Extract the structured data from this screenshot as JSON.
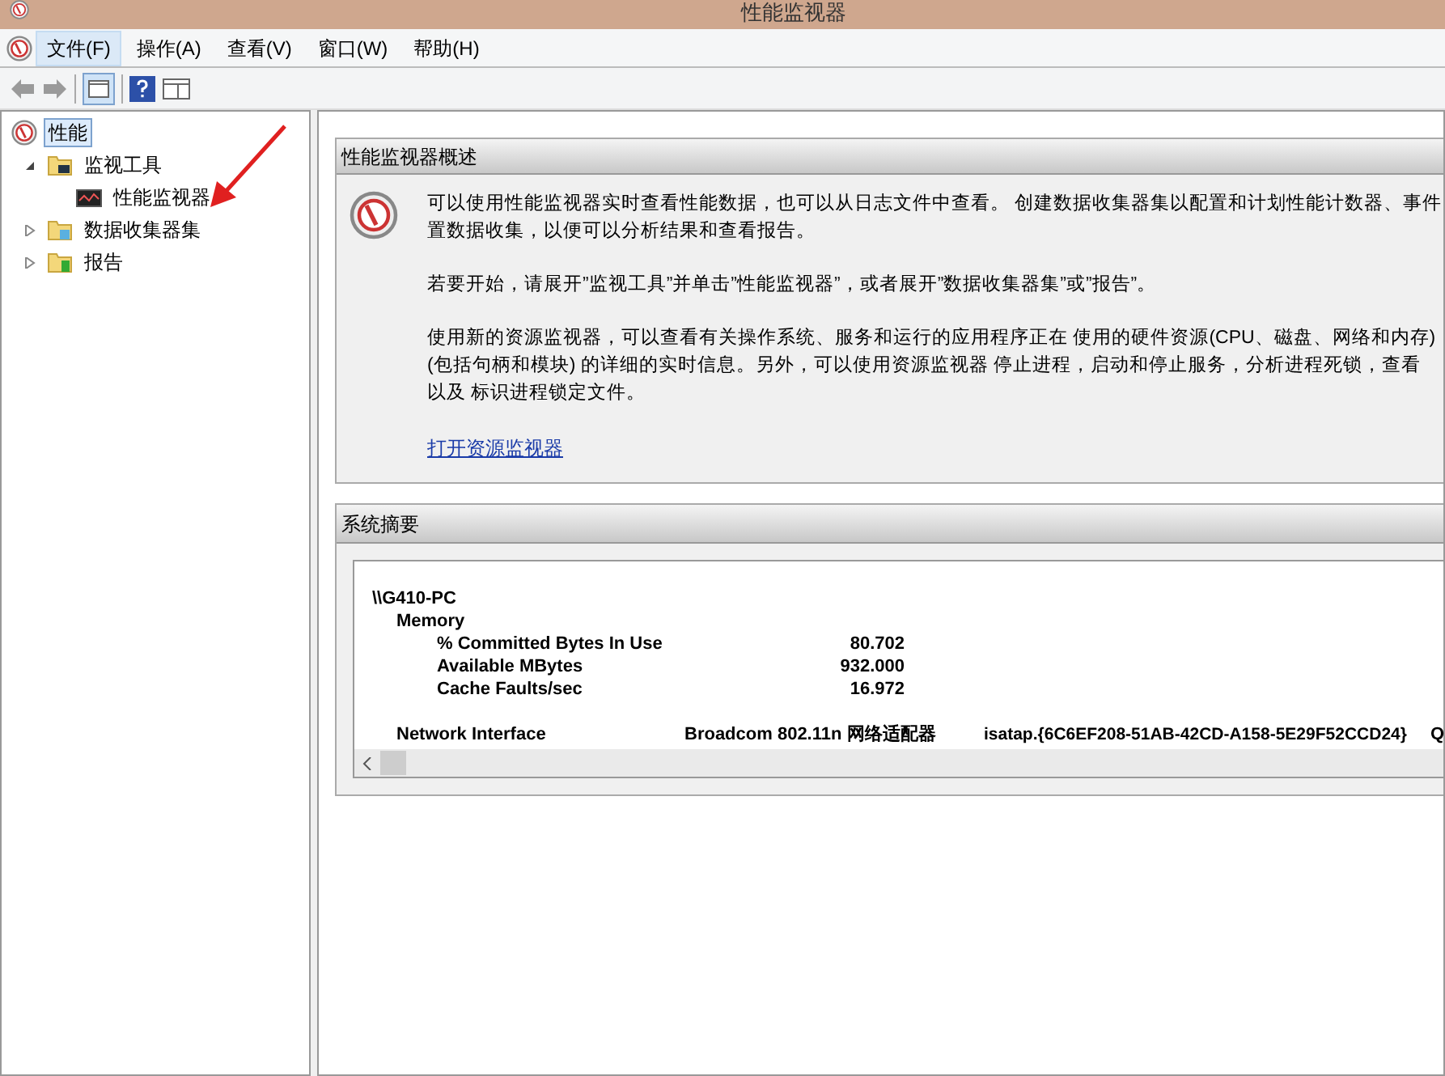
{
  "window": {
    "title": "性能监视器"
  },
  "menu": [
    {
      "label": "文件(F)",
      "selected": true
    },
    {
      "label": "操作(A)",
      "selected": false
    },
    {
      "label": "查看(V)",
      "selected": false
    },
    {
      "label": "窗口(W)",
      "selected": false
    },
    {
      "label": "帮助(H)",
      "selected": false
    }
  ],
  "tree": [
    {
      "label": "性能",
      "selected": true,
      "children": [
        {
          "label": "监视工具",
          "selected": false,
          "expanded": true,
          "children": [
            {
              "label": "性能监视器",
              "selected": false
            }
          ]
        },
        {
          "label": "数据收集器集",
          "selected": false,
          "expanded": false
        },
        {
          "label": "报告",
          "selected": false,
          "expanded": false
        }
      ]
    }
  ],
  "overview": {
    "title": "性能监视器概述",
    "paragraphs": [
      [
        "可以使用性能监视器实时查看性能数据，也可以从日志文件中查看。 创建数据收集器集以配置和计划性能计数器、事件",
        "置数据收集，以便可以分析结果和查看报告。"
      ],
      [
        "若要开始，请展开”监视工具”并单击”性能监视器”，或者展开”数据收集器集”或”报告”。"
      ],
      [
        "使用新的资源监视器，可以查看有关操作系统、服务和运行的应用程序正在 使用的硬件资源(CPU、磁盘、网络和内存)",
        "(包括句柄和模块) 的详细的实时信息。另外，可以使用资源监视器 停止进程，启动和停止服务，分析进程死锁，查看",
        "以及 标识进程锁定文件。"
      ]
    ],
    "link": "打开资源监视器"
  },
  "summary": {
    "title": "系统摘要",
    "computer": "\\\\G410-PC",
    "memory": {
      "label": "Memory",
      "counters": [
        {
          "name": "% Committed Bytes In Use",
          "value": "80.702"
        },
        {
          "name": "Available MBytes",
          "value": "932.000"
        },
        {
          "name": "Cache Faults/sec",
          "value": "16.972"
        }
      ]
    },
    "network": {
      "label": "Network Interface",
      "columns": [
        "Broadcom 802.11n 网络适配器",
        "isatap.{6C6EF208-51AB-42CD-A158-5E29F52CCD24}",
        "Q"
      ]
    }
  }
}
